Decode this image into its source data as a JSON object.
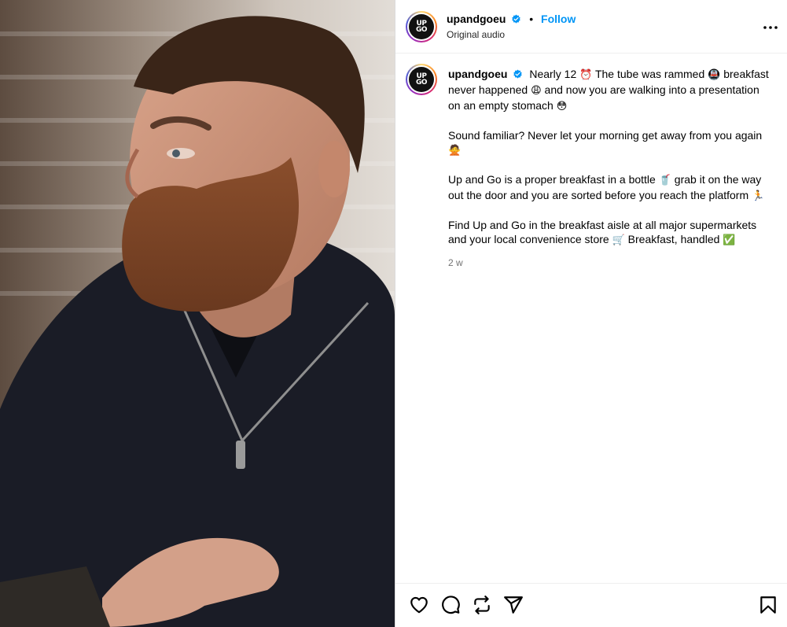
{
  "post": {
    "username": "upandgoeu",
    "follow_label": "Follow",
    "separator": "•",
    "audio": "Original audio",
    "avatar_text_top": "UP",
    "avatar_text_bottom": "GO",
    "timestamp": "2 w",
    "verified_color": "#0095f6"
  },
  "caption": {
    "p1_a": "Nearly 12",
    "p1_e1": "⏰",
    "p1_b": "The tube was rammed",
    "p1_e2": "🚇",
    "p1_c": "breakfast never happened",
    "p1_e3": "😩",
    "p1_d": "and now you are walking into a presentation on an empty stomach",
    "p1_e4": "😳",
    "p2_a": "Sound familiar? Never let your morning get away from you again",
    "p2_e1": "🙅",
    "p3_a": "Up and Go is a proper breakfast in a bottle",
    "p3_e1": "🥤",
    "p3_b": "grab it on the way out the door and you are sorted before you reach the platform",
    "p3_e2": "🏃",
    "p4_a": "Find Up and Go in the breakfast aisle at all major supermarkets and your local convenience store",
    "p4_e1": "🛒",
    "p4_b": "Breakfast, handled",
    "p4_e2": "✅"
  },
  "icons": {
    "more": "more-options-icon",
    "like": "heart-icon",
    "comment": "comment-icon",
    "repost": "repost-icon",
    "share": "share-icon",
    "save": "bookmark-icon"
  },
  "colors": {
    "accent": "#0095f6",
    "muted": "#737373",
    "border": "#efefef"
  }
}
